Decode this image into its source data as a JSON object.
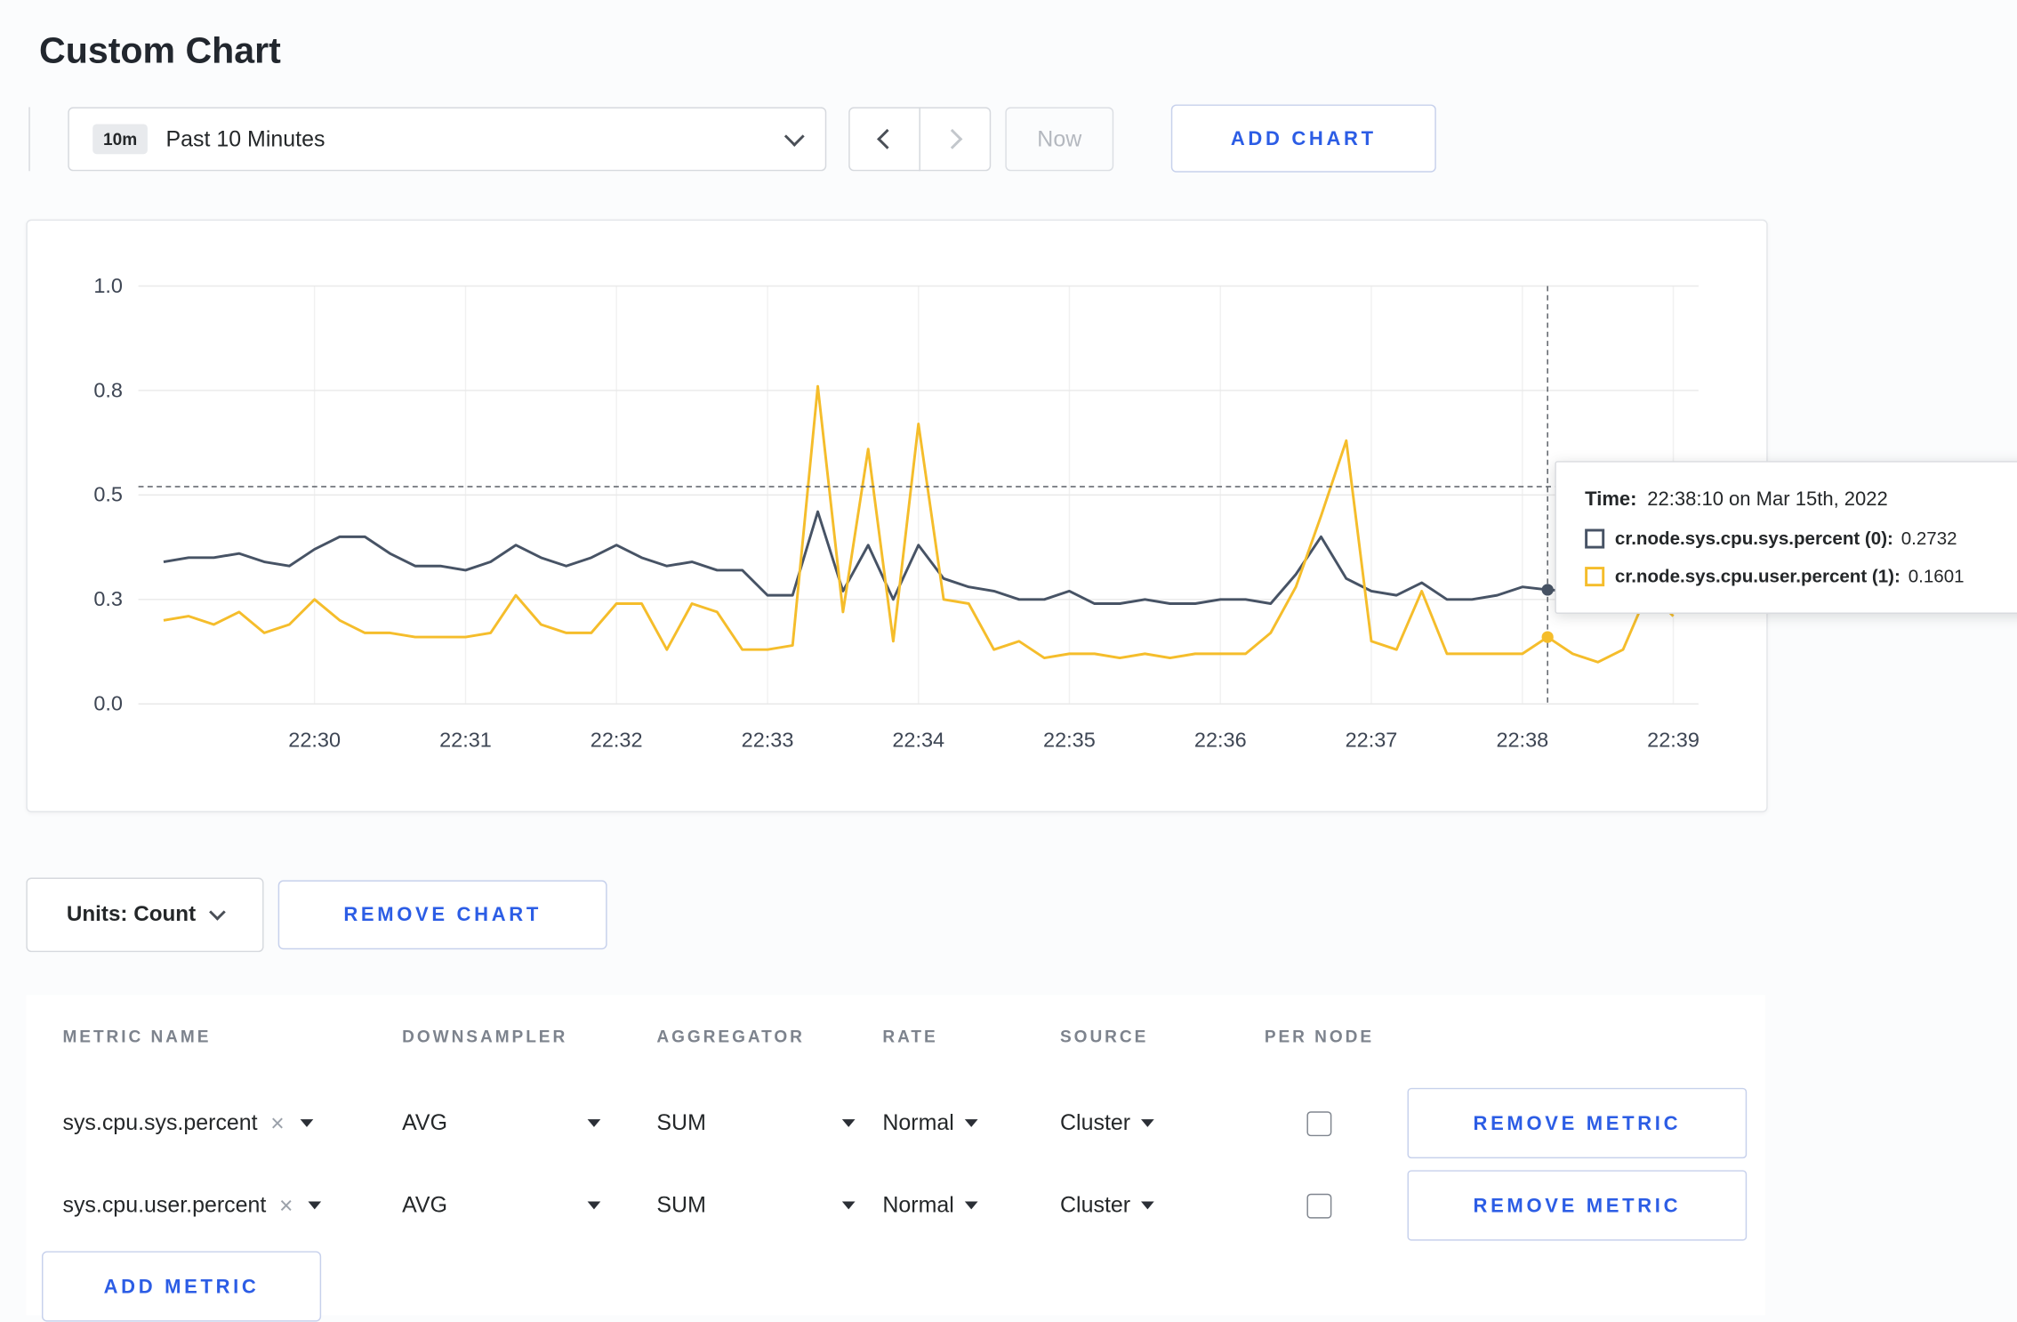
{
  "colors": {
    "accent": "#2c5de5",
    "series_sys": "#475365",
    "series_user": "#f5bd2b",
    "grid": "#e9e9e9",
    "axis_text": "#3e4654"
  },
  "page": {
    "title": "Custom Chart"
  },
  "icons": {
    "close": "×"
  },
  "toolbar": {
    "time_range_badge": "10m",
    "time_range_label": "Past 10 Minutes",
    "now_label": "Now",
    "add_chart_label": "ADD CHART"
  },
  "chart_data": {
    "type": "line",
    "title": "",
    "xlabel": "",
    "ylabel": "",
    "grid": true,
    "legend_position": "tooltip",
    "ylim": [
      0,
      1
    ],
    "x_start": "22:29:00",
    "x_step_seconds": 10,
    "x_domain": [
      "22:28:50",
      "22:39:10"
    ],
    "y_ticks": [
      {
        "value": 0,
        "label": "0.0"
      },
      {
        "value": 0.25,
        "label": "0.3"
      },
      {
        "value": 0.5,
        "label": "0.5"
      },
      {
        "value": 0.75,
        "label": "0.8"
      },
      {
        "value": 1,
        "label": "1.0"
      }
    ],
    "x_ticks": [
      {
        "time": "22:30:00",
        "label": "22:30"
      },
      {
        "time": "22:31:00",
        "label": "22:31"
      },
      {
        "time": "22:32:00",
        "label": "22:32"
      },
      {
        "time": "22:33:00",
        "label": "22:33"
      },
      {
        "time": "22:34:00",
        "label": "22:34"
      },
      {
        "time": "22:35:00",
        "label": "22:35"
      },
      {
        "time": "22:36:00",
        "label": "22:36"
      },
      {
        "time": "22:37:00",
        "label": "22:37"
      },
      {
        "time": "22:38:00",
        "label": "22:38"
      },
      {
        "time": "22:39:00",
        "label": "22:39"
      }
    ],
    "series": [
      {
        "name": "cr.node.sys.cpu.sys.percent",
        "color": "#475365",
        "values": [
          0.34,
          0.35,
          0.35,
          0.36,
          0.34,
          0.33,
          0.37,
          0.4,
          0.4,
          0.36,
          0.33,
          0.33,
          0.32,
          0.34,
          0.38,
          0.35,
          0.33,
          0.35,
          0.38,
          0.35,
          0.33,
          0.34,
          0.32,
          0.32,
          0.26,
          0.26,
          0.46,
          0.27,
          0.38,
          0.25,
          0.38,
          0.3,
          0.28,
          0.27,
          0.25,
          0.25,
          0.27,
          0.24,
          0.24,
          0.25,
          0.24,
          0.24,
          0.25,
          0.25,
          0.24,
          0.31,
          0.4,
          0.3,
          0.27,
          0.26,
          0.29,
          0.25,
          0.25,
          0.26,
          0.28,
          0.2732,
          0.27,
          0.31,
          0.3,
          0.29,
          0.3
        ]
      },
      {
        "name": "cr.node.sys.cpu.user.percent",
        "color": "#f5bd2b",
        "values": [
          0.2,
          0.21,
          0.19,
          0.22,
          0.17,
          0.19,
          0.25,
          0.2,
          0.17,
          0.17,
          0.16,
          0.16,
          0.16,
          0.17,
          0.26,
          0.19,
          0.17,
          0.17,
          0.24,
          0.24,
          0.13,
          0.24,
          0.22,
          0.13,
          0.13,
          0.14,
          0.76,
          0.22,
          0.61,
          0.15,
          0.67,
          0.25,
          0.24,
          0.13,
          0.15,
          0.11,
          0.12,
          0.12,
          0.11,
          0.12,
          0.11,
          0.12,
          0.12,
          0.12,
          0.17,
          0.28,
          0.45,
          0.63,
          0.15,
          0.13,
          0.27,
          0.12,
          0.12,
          0.12,
          0.12,
          0.1601,
          0.12,
          0.1,
          0.13,
          0.27,
          0.21
        ]
      }
    ],
    "crosshair": {
      "time": "22:38:10",
      "hover_value": 0.52,
      "points": [
        {
          "series": "cr.node.sys.cpu.sys.percent",
          "value": 0.2732,
          "color": "#475365"
        },
        {
          "series": "cr.node.sys.cpu.user.percent",
          "value": 0.1601,
          "color": "#f5bd2b"
        }
      ]
    }
  },
  "tooltip": {
    "time_label": "Time:",
    "time_value": "22:38:10 on Mar 15th, 2022",
    "series": [
      {
        "label": "cr.node.sys.cpu.sys.percent (0):",
        "value": "0.2732",
        "color": "#475365"
      },
      {
        "label": "cr.node.sys.cpu.user.percent (1):",
        "value": "0.1601",
        "color": "#f5bd2b"
      }
    ]
  },
  "controls": {
    "units_label": "Units: Count",
    "remove_chart_label": "REMOVE CHART",
    "add_metric_label": "ADD METRIC"
  },
  "table": {
    "headers": [
      "METRIC NAME",
      "DOWNSAMPLER",
      "AGGREGATOR",
      "RATE",
      "SOURCE",
      "PER NODE"
    ],
    "rows": [
      {
        "metric": "sys.cpu.sys.percent",
        "downsampler": "AVG",
        "aggregator": "SUM",
        "rate": "Normal",
        "source": "Cluster",
        "per_node_checked": false,
        "remove_label": "REMOVE METRIC"
      },
      {
        "metric": "sys.cpu.user.percent",
        "downsampler": "AVG",
        "aggregator": "SUM",
        "rate": "Normal",
        "source": "Cluster",
        "per_node_checked": false,
        "remove_label": "REMOVE METRIC"
      }
    ]
  }
}
